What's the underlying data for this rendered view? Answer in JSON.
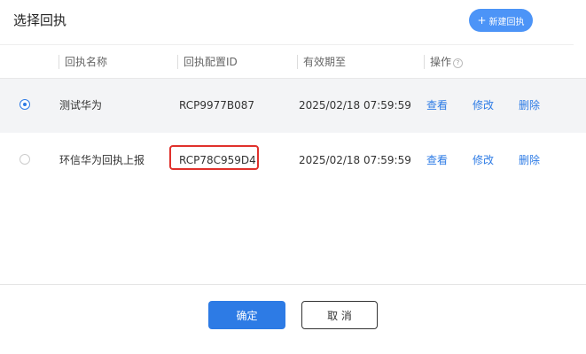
{
  "dialog": {
    "title": "选择回执",
    "new_button": {
      "icon": "plus-icon",
      "label": "新建回执"
    }
  },
  "table": {
    "headers": {
      "name": "回执名称",
      "config_id": "回执配置ID",
      "expiry": "有效期至",
      "actions": "操作",
      "actions_help_icon": "question-icon"
    },
    "rows": [
      {
        "selected": true,
        "name": "测试华为",
        "config_id": "RCP9977B087",
        "expiry": "2025/02/18 07:59:59",
        "view": "查看",
        "edit": "修改",
        "delete": "删除"
      },
      {
        "selected": false,
        "name": "环信华为回执上报",
        "config_id": "RCP78C959D4",
        "expiry": "2025/02/18 07:59:59",
        "view": "查看",
        "edit": "修改",
        "delete": "删除"
      }
    ]
  },
  "footer": {
    "confirm_label": "确定",
    "cancel_label": "取 消"
  },
  "colors": {
    "primary": "#2d7be5",
    "new_button": "#4c94f7",
    "highlight": "#e0312c"
  }
}
